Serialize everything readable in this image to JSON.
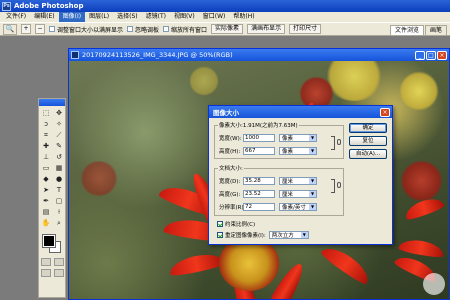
{
  "app": {
    "title": "Adobe Photoshop"
  },
  "menu": [
    {
      "label": "文件(F)"
    },
    {
      "label": "编辑(E)"
    },
    {
      "label": "图像(I)"
    },
    {
      "label": "图层(L)"
    },
    {
      "label": "选择(S)"
    },
    {
      "label": "滤镜(T)"
    },
    {
      "label": "视图(V)"
    },
    {
      "label": "窗口(W)"
    },
    {
      "label": "帮助(H)"
    }
  ],
  "options_bar": {
    "resize_windows_label": "调整窗口大小以满屏显示",
    "ignore_palettes_label": "忽略调板",
    "zoom_all_windows_label": "缩放所有窗口",
    "actual_pixels_label": "实际像素",
    "fit_on_screen_label": "满画布显示",
    "print_size_label": "打印尺寸",
    "palette_tab_1": "文件浏览",
    "palette_tab_2": "画笔"
  },
  "document": {
    "title": "20170924113526_IMG_3344.JPG @ 50%(RGB)"
  },
  "dialog": {
    "title": "图像大小",
    "pixel_dimensions_label": "像素大小:1.91M(之前为7.63M)",
    "width_label": "宽度(W):",
    "width_value": "1000",
    "width_unit": "像素",
    "height_label": "高度(H):",
    "height_value": "667",
    "height_unit": "像素",
    "doc_size_label": "文档大小:",
    "doc_width_label": "宽度(D):",
    "doc_width_value": "35.28",
    "doc_width_unit": "厘米",
    "doc_height_label": "高度(G):",
    "doc_height_value": "23.52",
    "doc_height_unit": "厘米",
    "resolution_label": "分辨率(R):",
    "resolution_value": "72",
    "resolution_unit": "像素/英寸",
    "constrain_label": "约束比例(C)",
    "constrain_checked": true,
    "resample_label": "重定图像像素(I):",
    "resample_checked": true,
    "resample_method": "两次立方",
    "ok_label": "确定",
    "cancel_label": "复位",
    "auto_label": "自动(A)..."
  }
}
